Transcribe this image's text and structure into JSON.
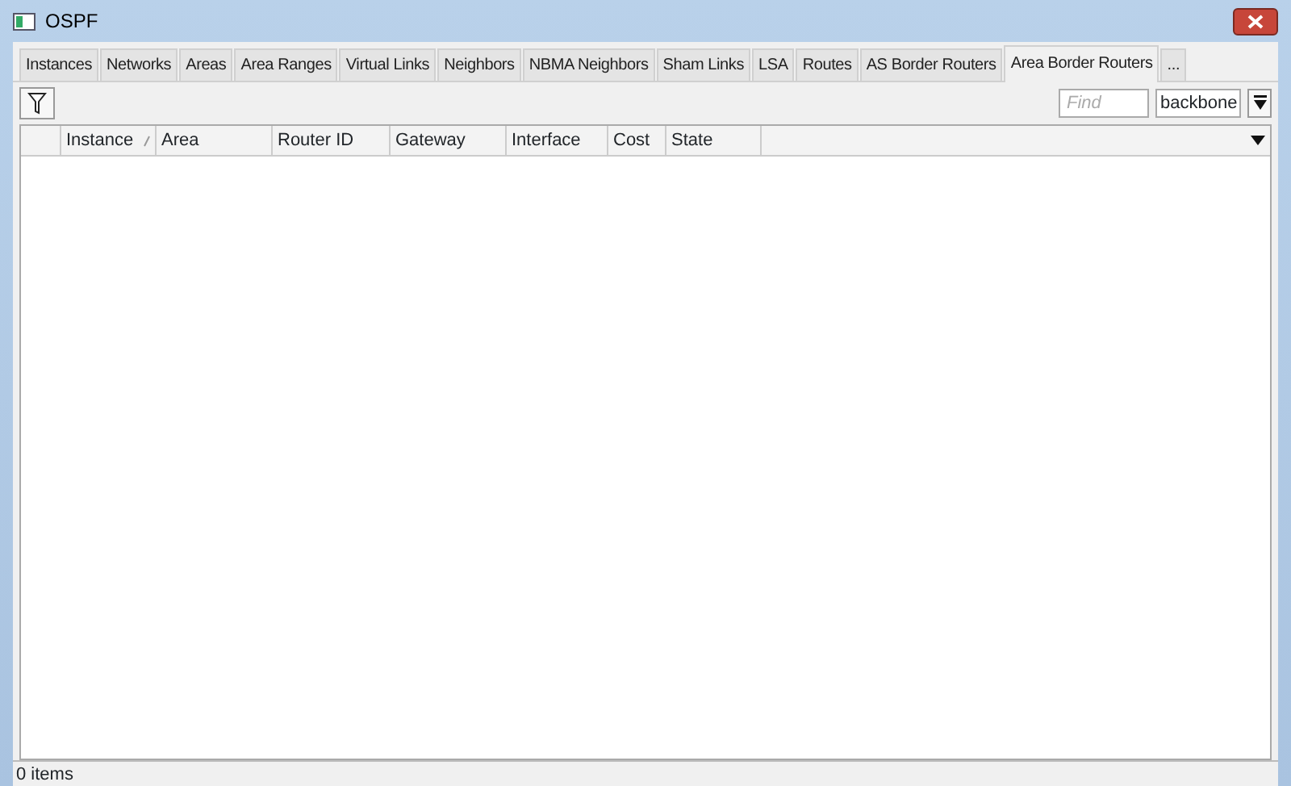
{
  "window": {
    "title": "OSPF"
  },
  "tabs": [
    {
      "label": "Instances",
      "selected": false
    },
    {
      "label": "Networks",
      "selected": false
    },
    {
      "label": "Areas",
      "selected": false
    },
    {
      "label": "Area Ranges",
      "selected": false
    },
    {
      "label": "Virtual Links",
      "selected": false
    },
    {
      "label": "Neighbors",
      "selected": false
    },
    {
      "label": "NBMA Neighbors",
      "selected": false
    },
    {
      "label": "Sham Links",
      "selected": false
    },
    {
      "label": "LSA",
      "selected": false
    },
    {
      "label": "Routes",
      "selected": false
    },
    {
      "label": "AS Border Routers",
      "selected": false
    },
    {
      "label": "Area Border Routers",
      "selected": true
    }
  ],
  "more_tabs": "...",
  "toolbar": {
    "find": {
      "placeholder": "Find"
    },
    "filter_select": "backbone"
  },
  "table": {
    "columns": [
      {
        "label": "Instance",
        "sorted": true
      },
      {
        "label": "Area",
        "sorted": false
      },
      {
        "label": "Router ID",
        "sorted": false
      },
      {
        "label": "Gateway",
        "sorted": false
      },
      {
        "label": "Interface",
        "sorted": false
      },
      {
        "label": "Cost",
        "sorted": false
      },
      {
        "label": "State",
        "sorted": false
      }
    ]
  },
  "status_bar": "0 items"
}
